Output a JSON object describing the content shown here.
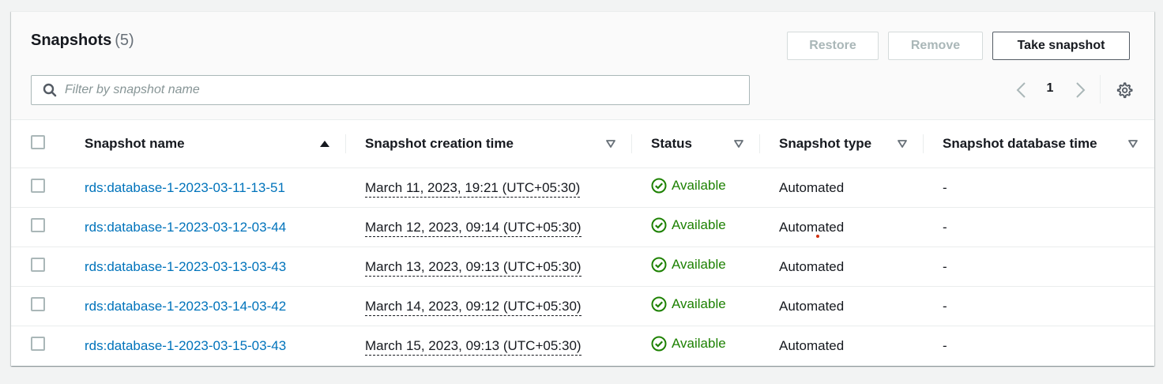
{
  "header": {
    "title": "Snapshots",
    "count": "(5)",
    "buttons": {
      "restore": "Restore",
      "remove": "Remove",
      "take_snapshot": "Take snapshot"
    },
    "search": {
      "placeholder": "Filter by snapshot name",
      "value": ""
    },
    "pagination": {
      "current_page": "1"
    }
  },
  "table": {
    "columns": [
      {
        "label": "Snapshot name",
        "sort": "ascending"
      },
      {
        "label": "Snapshot creation time",
        "sort": "none"
      },
      {
        "label": "Status",
        "sort": "none"
      },
      {
        "label": "Snapshot type",
        "sort": "none"
      },
      {
        "label": "Snapshot database time",
        "sort": "none"
      }
    ],
    "rows": [
      {
        "name": "rds:database-1-2023-03-11-13-51",
        "created": "March 11, 2023, 19:21 (UTC+05:30)",
        "status": "Available",
        "type": "Automated",
        "db_time": "-"
      },
      {
        "name": "rds:database-1-2023-03-12-03-44",
        "created": "March 12, 2023, 09:14 (UTC+05:30)",
        "status": "Available",
        "type": "Automated",
        "db_time": "-"
      },
      {
        "name": "rds:database-1-2023-03-13-03-43",
        "created": "March 13, 2023, 09:13 (UTC+05:30)",
        "status": "Available",
        "type": "Automated",
        "db_time": "-"
      },
      {
        "name": "rds:database-1-2023-03-14-03-42",
        "created": "March 14, 2023, 09:12 (UTC+05:30)",
        "status": "Available",
        "type": "Automated",
        "db_time": "-"
      },
      {
        "name": "rds:database-1-2023-03-15-03-43",
        "created": "March 15, 2023, 09:13 (UTC+05:30)",
        "status": "Available",
        "type": "Automated",
        "db_time": "-"
      }
    ]
  },
  "colors": {
    "link": "#0073bb",
    "status_ok": "#1d8102",
    "border": "#eaeded",
    "disabled_text": "#aab7b8"
  },
  "icons": {
    "search": "search-icon",
    "prev": "chevron-left-icon",
    "next": "chevron-right-icon",
    "settings": "gear-icon",
    "sort_asc": "sort-ascending-icon",
    "sort_none": "sort-descending-outline-icon",
    "status": "check-circle-icon"
  }
}
